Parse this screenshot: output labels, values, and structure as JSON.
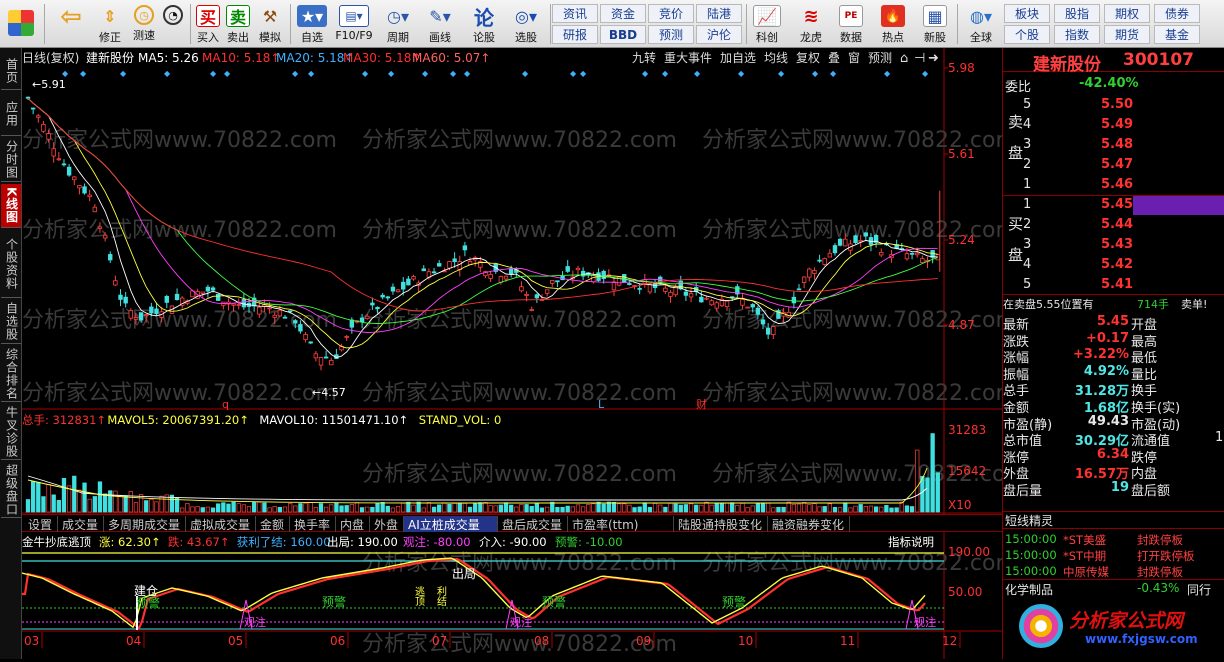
{
  "toolbar": {
    "logo": "",
    "buttons": [
      {
        "label": "",
        "icon": "back-arrow-icon"
      },
      {
        "label": "修正",
        "icon": "up-down-icon"
      },
      {
        "label": "测速",
        "icon": "stopwatch-icon"
      },
      {
        "label": "",
        "icon": "clock-icon"
      },
      {
        "label": "买入",
        "icon": "buy-icon",
        "glyph": "买"
      },
      {
        "label": "卖出",
        "icon": "sell-icon",
        "glyph": "卖"
      },
      {
        "label": "模拟",
        "icon": "hammer-icon"
      },
      {
        "label": "自选",
        "icon": "star-folder-icon"
      },
      {
        "label": "F10/F9",
        "icon": "f10-icon"
      },
      {
        "label": "周期",
        "icon": "period-icon"
      },
      {
        "label": "画线",
        "icon": "pencil-icon"
      },
      {
        "label": "论股",
        "icon": "discuss-icon"
      },
      {
        "label": "选股",
        "icon": "select-stock-icon"
      },
      {
        "label": "科创",
        "icon": "kechuang-icon"
      },
      {
        "label": "龙虎",
        "icon": "dragon-tiger-icon"
      },
      {
        "label": "数据",
        "icon": "data-icon"
      },
      {
        "label": "热点",
        "icon": "hot-icon"
      },
      {
        "label": "新股",
        "icon": "new-stock-icon"
      },
      {
        "label": "全球",
        "icon": "globe-icon"
      }
    ],
    "small": [
      [
        "资讯",
        "研报"
      ],
      [
        "资金",
        "BBD"
      ],
      [
        "竞价",
        "预测"
      ],
      [
        "陆港",
        "沪伦"
      ]
    ],
    "right": [
      [
        "板块",
        "个股"
      ],
      [
        "股指",
        "指数"
      ],
      [
        "期权",
        "期货"
      ],
      [
        "债券",
        "基金"
      ]
    ]
  },
  "nav": [
    "首页",
    "应用",
    "分时图",
    "K线图",
    "个股资料",
    "自选股",
    "综合排名",
    "牛叉诊股",
    "超级盘口"
  ],
  "chart": {
    "header": {
      "left": "日线(复权)",
      "name": "建新股份",
      "ma5": "MA5: 5.26",
      "ma10": "MA10: 5.18↑",
      "ma20": "MA20: 5.18↑",
      "ma30": "MA30: 5.18↑",
      "ma60": "MA60: 5.07↑"
    },
    "right_buttons": [
      "九转",
      "重大事件",
      "加自选",
      "均线",
      "复权",
      "叠",
      "窗",
      "预测"
    ],
    "price_axis": [
      "5.98",
      "5.61",
      "5.24",
      "4.87"
    ],
    "hi_label": "5.91",
    "lo_label": "4.57",
    "markers": [
      "q",
      "L",
      "财"
    ],
    "vol_header": {
      "total": "总手: 312831↑",
      "mavol5": "MAVOL5: 20067391.20↑",
      "mavol10": "MAVOL10: 11501471.10↑",
      "stand": "STAND_VOL: 0"
    },
    "vol_axis": [
      "31283",
      "15642",
      "X10"
    ],
    "tabs": [
      "设置",
      "成交量",
      "多周期成交量",
      "虚拟成交量",
      "金额",
      "换手率",
      "内盘",
      "外盘",
      "AI立桩成交量",
      "盘后成交量",
      "市盈率(ttm)",
      "陆股通持股变化",
      "融资融券变化"
    ],
    "active_tab": "AI立桩成交量",
    "ind_header": {
      "name": "金牛抄底逃顶",
      "zhang": "涨: 62.30↑",
      "die": "跌: 43.67↑",
      "jieli": "获利了结: 160.00",
      "chuju": "出局: 190.00",
      "guanzhu": "观注: -80.00",
      "jieru": "介入: -90.00",
      "yujing": "预警: -10.00",
      "explain": "指标说明"
    },
    "ind_axis": [
      "190.00",
      "50.00"
    ],
    "ind_labels": {
      "jiancang": "建仓",
      "yujing": "预警",
      "guanzhu": "观注",
      "taoji": "逃顶",
      "lijie": "利结",
      "chuju": "出局"
    },
    "months": [
      "03",
      "04",
      "05",
      "06",
      "07",
      "08",
      "09",
      "10",
      "11",
      "12"
    ],
    "watermark": "分析家公式网www.70822.com"
  },
  "quote": {
    "title": "建新股份",
    "code": "300107",
    "weibi_label": "委比",
    "weibi": "-42.40%",
    "sell_label": "卖盘",
    "buy_label": "买盘",
    "sell": [
      {
        "n": "5",
        "p": "5.50",
        "v": ""
      },
      {
        "n": "4",
        "p": "5.49",
        "v": ""
      },
      {
        "n": "3",
        "p": "5.48",
        "v": ""
      },
      {
        "n": "2",
        "p": "5.47",
        "v": ""
      },
      {
        "n": "1",
        "p": "5.46",
        "v": ""
      }
    ],
    "buy": [
      {
        "n": "1",
        "p": "5.45",
        "v": ""
      },
      {
        "n": "2",
        "p": "5.44",
        "v": ""
      },
      {
        "n": "3",
        "p": "5.43",
        "v": ""
      },
      {
        "n": "4",
        "p": "5.42",
        "v": ""
      },
      {
        "n": "5",
        "p": "5.41",
        "v": ""
      }
    ],
    "note": "在卖盘5.55位置有",
    "note_vol": "714手",
    "note_sell": "卖单!",
    "stats": [
      [
        "最新",
        "5.45",
        "开盘",
        ""
      ],
      [
        "涨跌",
        "+0.17",
        "最高",
        ""
      ],
      [
        "涨幅",
        "+3.22%",
        "最低",
        ""
      ],
      [
        "振幅",
        "4.92%",
        "量比",
        ""
      ],
      [
        "总手",
        "31.28万",
        "换手",
        ""
      ],
      [
        "金额",
        "1.68亿",
        "换手(实)",
        ""
      ],
      [
        "市盈(静)",
        "49.43",
        "市盈(动)",
        ""
      ],
      [
        "总市值",
        "30.29亿",
        "流通值",
        "1"
      ],
      [
        "涨停",
        "6.34",
        "跌停",
        ""
      ],
      [
        "外盘",
        "16.57万",
        "内盘",
        ""
      ],
      [
        "盘后量",
        "19",
        "盘后额",
        ""
      ]
    ],
    "short_title": "短线精灵",
    "short": [
      [
        "15:00:00",
        "*ST美盛",
        "封跌停板"
      ],
      [
        "15:00:00",
        "*ST中期",
        "打开跌停板"
      ],
      [
        "15:00:00",
        "中原传媒",
        "封跌停板"
      ]
    ],
    "sector": "化学制品",
    "sector_pct": "-0.43%",
    "sector_more": "同行",
    "site": "分析家公式网",
    "site_url": "www.fxjgsw.com"
  }
}
